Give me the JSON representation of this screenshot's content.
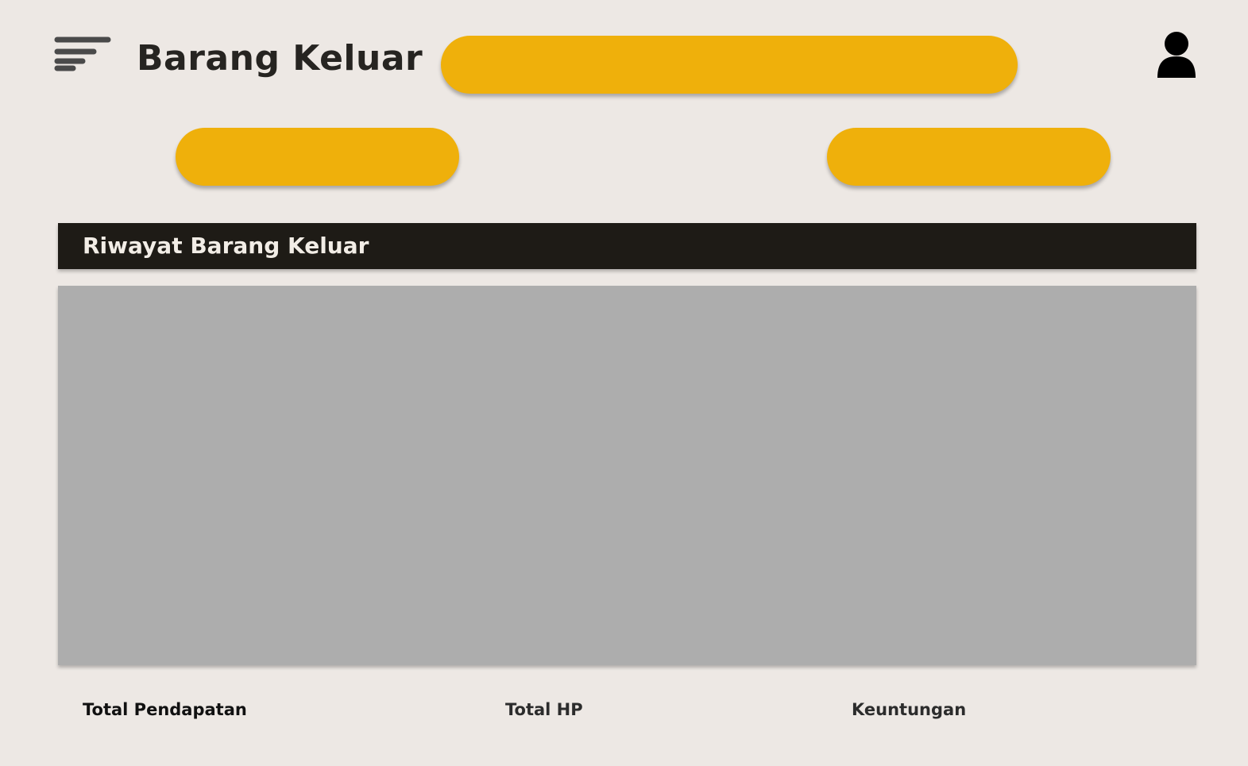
{
  "header": {
    "title": "Barang Keluar",
    "menu_icon": "menu-lines-icon",
    "user_icon": "user-icon"
  },
  "section": {
    "title": "Riwayat Barang Keluar"
  },
  "summary": {
    "total_pendapatan_label": "Total Pendapatan",
    "total_hp_label": "Total HP",
    "keuntungan_label": "Keuntungan"
  },
  "colors": {
    "background": "#ede8e4",
    "accent": "#efb00b",
    "header_bar": "#1e1b16",
    "panel": "#adadad",
    "title_text": "#262421"
  }
}
